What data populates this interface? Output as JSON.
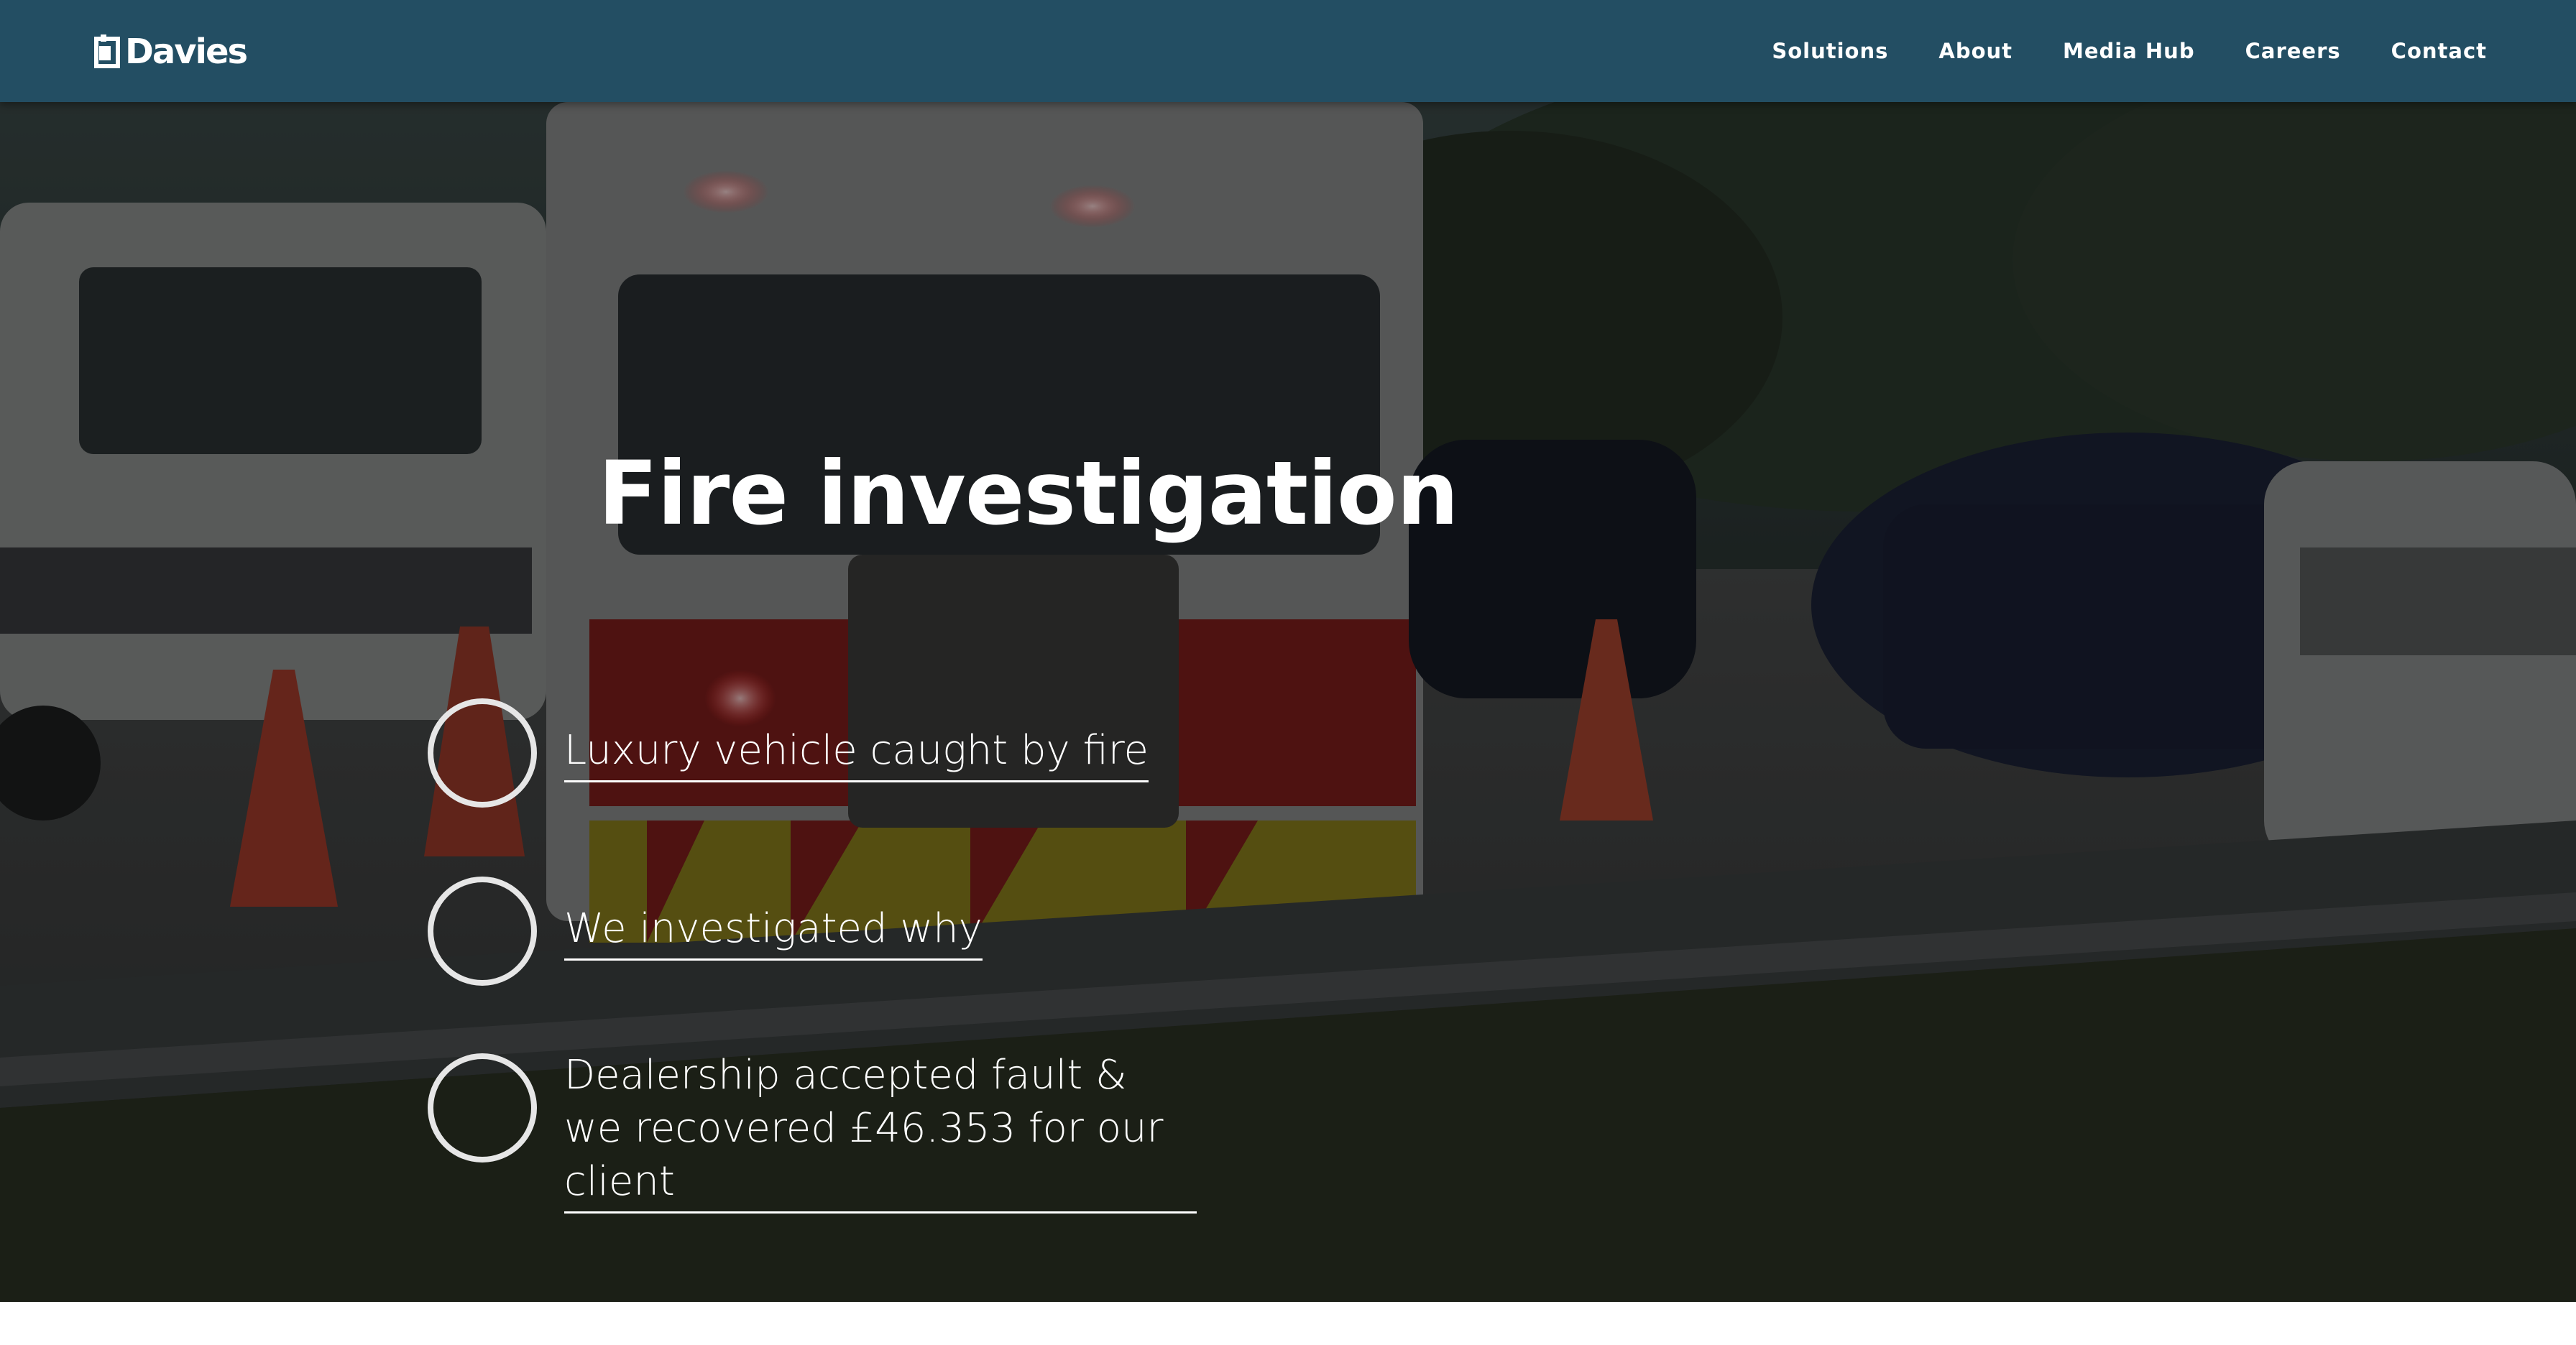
{
  "header": {
    "logo_text": "Davies",
    "nav": [
      {
        "label": "Solutions"
      },
      {
        "label": "About"
      },
      {
        "label": "Media Hub"
      },
      {
        "label": "Careers"
      },
      {
        "label": "Contact"
      }
    ]
  },
  "hero": {
    "title": "Fire investigation",
    "steps": [
      {
        "text": "Luxury vehicle caught by fire"
      },
      {
        "text": "We investigated why"
      },
      {
        "text": "Dealership accepted fault & we recovered £46.353 for our client"
      }
    ]
  },
  "colors": {
    "navbar": "#234e63",
    "text": "#ffffff",
    "circle_border": "#e6e6e6"
  }
}
